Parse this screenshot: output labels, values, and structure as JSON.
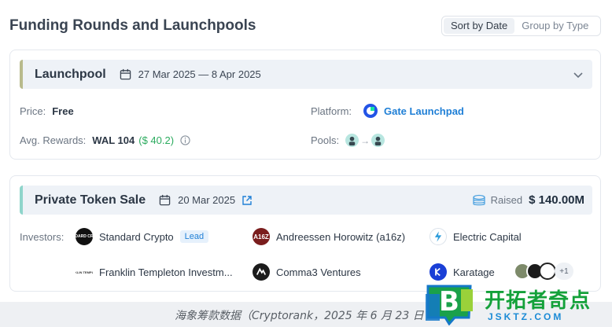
{
  "page": {
    "title": "Funding Rounds and Launchpools"
  },
  "sort": {
    "options": [
      "Sort by Date",
      "Group by Type"
    ],
    "active": "Sort by Date"
  },
  "launchpool": {
    "title": "Launchpool",
    "dates": "27 Mar 2025 — 8 Apr 2025",
    "price_label": "Price:",
    "price_value": "Free",
    "rewards_label": "Avg. Rewards:",
    "rewards_value": "WAL 104",
    "rewards_usd": "($ 40.2)",
    "platform_label": "Platform:",
    "platform_value": "Gate Launchpad",
    "pools_label": "Pools:",
    "accent_color": "#b8ba8c"
  },
  "private_sale": {
    "title": "Private Token Sale",
    "date": "20 Mar 2025",
    "raised_label": "Raised",
    "raised_value": "$ 140.00M",
    "investors_label": "Investors:",
    "accent_color": "#8fd5cb",
    "investors": [
      {
        "name": "Standard Crypto",
        "lead": "Lead",
        "logo_text": "STANDARD CRYPTO"
      },
      {
        "name": "Andreessen Horowitz (a16z)",
        "logo_text": "A16Z"
      },
      {
        "name": "Electric Capital"
      },
      {
        "name": "Franklin Templeton Investm...",
        "logo_text": "FRANKLIN TEMPLETON"
      },
      {
        "name": "Comma3 Ventures"
      },
      {
        "name": "Karatage"
      }
    ],
    "more_count": "+1"
  },
  "caption": {
    "text": "海象筹款数据（Cryptorank，2025 年 6 月 23 日"
  },
  "watermark": {
    "title": "开拓者奇点",
    "subtitle": "JSKTZ.COM",
    "badge_letter": "B"
  }
}
